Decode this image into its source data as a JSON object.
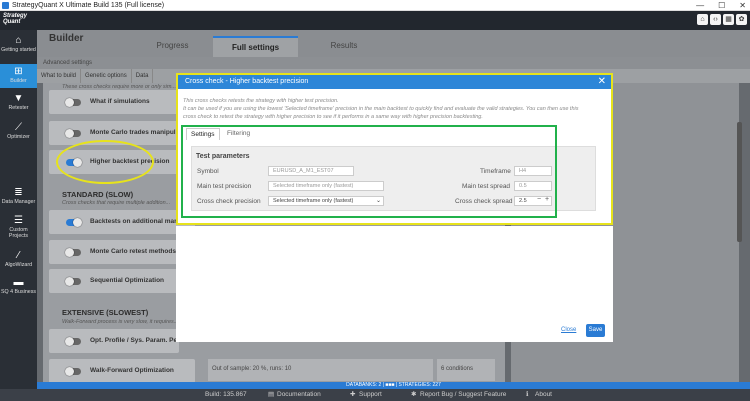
{
  "window": {
    "title": "StrategyQuant X Ultimate Build 135 (Full license)",
    "controls": [
      "—",
      "☐",
      "✕"
    ]
  },
  "topbar": {
    "logo_line1": "Strategy",
    "logo_line2": "Quant",
    "icons": [
      "home-icon",
      "code-icon",
      "grid-icon",
      "gear-icon"
    ]
  },
  "leftnav": {
    "items": [
      {
        "label": "Getting started",
        "icon": "home-icon",
        "active": false
      },
      {
        "label": "Builder",
        "icon": "plus-icon",
        "active": true
      },
      {
        "label": "Retester",
        "icon": "filter-icon",
        "active": false
      },
      {
        "label": "Optimizer",
        "icon": "chart-icon",
        "active": false
      },
      {
        "label": "Data Manager",
        "icon": "database-icon",
        "active": false
      },
      {
        "label": "Custom Projects",
        "icon": "list-icon",
        "active": false
      },
      {
        "label": "AlgoWizard",
        "icon": "wand-icon",
        "active": false
      },
      {
        "label": "SQ 4 Business",
        "icon": "briefcase-icon",
        "active": false
      }
    ]
  },
  "builder": {
    "title": "Builder",
    "tabs": [
      {
        "label": "Progress",
        "active": false
      },
      {
        "label": "Full settings",
        "active": true
      },
      {
        "label": "Results",
        "active": false
      }
    ],
    "advanced_label": "Advanced settings",
    "subtabs": [
      "What to build",
      "Genetic options",
      "Data"
    ]
  },
  "checks": {
    "top_desc": "These cross checks require more or only sim...",
    "rows": [
      {
        "label": "What if simulations",
        "on": false
      },
      {
        "label": "Monte Carlo trades manipul...",
        "on": false
      },
      {
        "label": "Higher backtest precision",
        "on": true
      }
    ],
    "standard_head": "STANDARD (SLOW)",
    "standard_desc": "Cross checks that require multiple addition...",
    "rows2": [
      {
        "label": "Backtests on additional mar...",
        "on": true
      },
      {
        "label": "Monte Carlo retest methods",
        "on": false
      },
      {
        "label": "Sequential Optimization",
        "on": false
      }
    ],
    "extensive_head": "EXTENSIVE (SLOWEST)",
    "extensive_desc": "Walk-Forward process is very slow, it requires...",
    "rows3": [
      {
        "label": "Opt. Profile / Sys. Param. Per...",
        "on": false
      },
      {
        "label": "Walk-Forward Optimization",
        "on": false
      }
    ],
    "wfo_summary": "Out of sample: 20 %, runs: 10",
    "wfo_conditions": "6 conditions"
  },
  "dialog": {
    "title": "Cross check - Higher backtest precision",
    "desc_line1": "This cross checks retests the strategy with higher test precision.",
    "desc_line2": "It can be used if you are using the lowest 'Selected timeframe' precision in the main backtest to quickly find and evaluate the valid strategies. You can then use this",
    "desc_line3": "cross check to retest the strategy with higher precision to see if it performs in a same way with higher precision backtesting.",
    "tabs": [
      "Settings",
      "Filtering"
    ],
    "params_title": "Test parameters",
    "symbol_label": "Symbol",
    "symbol_value": "EURUSD_A_M1_EST07",
    "timeframe_label": "Timeframe",
    "timeframe_value": "H4",
    "main_prec_label": "Main test precision",
    "main_prec_value": "Selected timeframe only (fastest)",
    "main_spread_label": "Main test spread",
    "main_spread_value": "0.5",
    "cc_prec_label": "Cross check precision",
    "cc_prec_value": "Selected timeframe only (fastest)",
    "cc_spread_label": "Cross check spread",
    "cc_spread_value": "2.5",
    "close_label": "Close",
    "save_label": "Save"
  },
  "bottomstrip": {
    "text": "DATABANKS: 2  |  ■■■  |  STRATEGIES: 227"
  },
  "statusbar": {
    "build": "Build: 135.867",
    "documentation": "Documentation",
    "support": "Support",
    "report": "Report Bug / Suggest Feature",
    "about": "About"
  },
  "colors": {
    "accent": "#2a7bd4",
    "highlight_yellow": "#e7e31b",
    "highlight_green": "#21b14b"
  }
}
